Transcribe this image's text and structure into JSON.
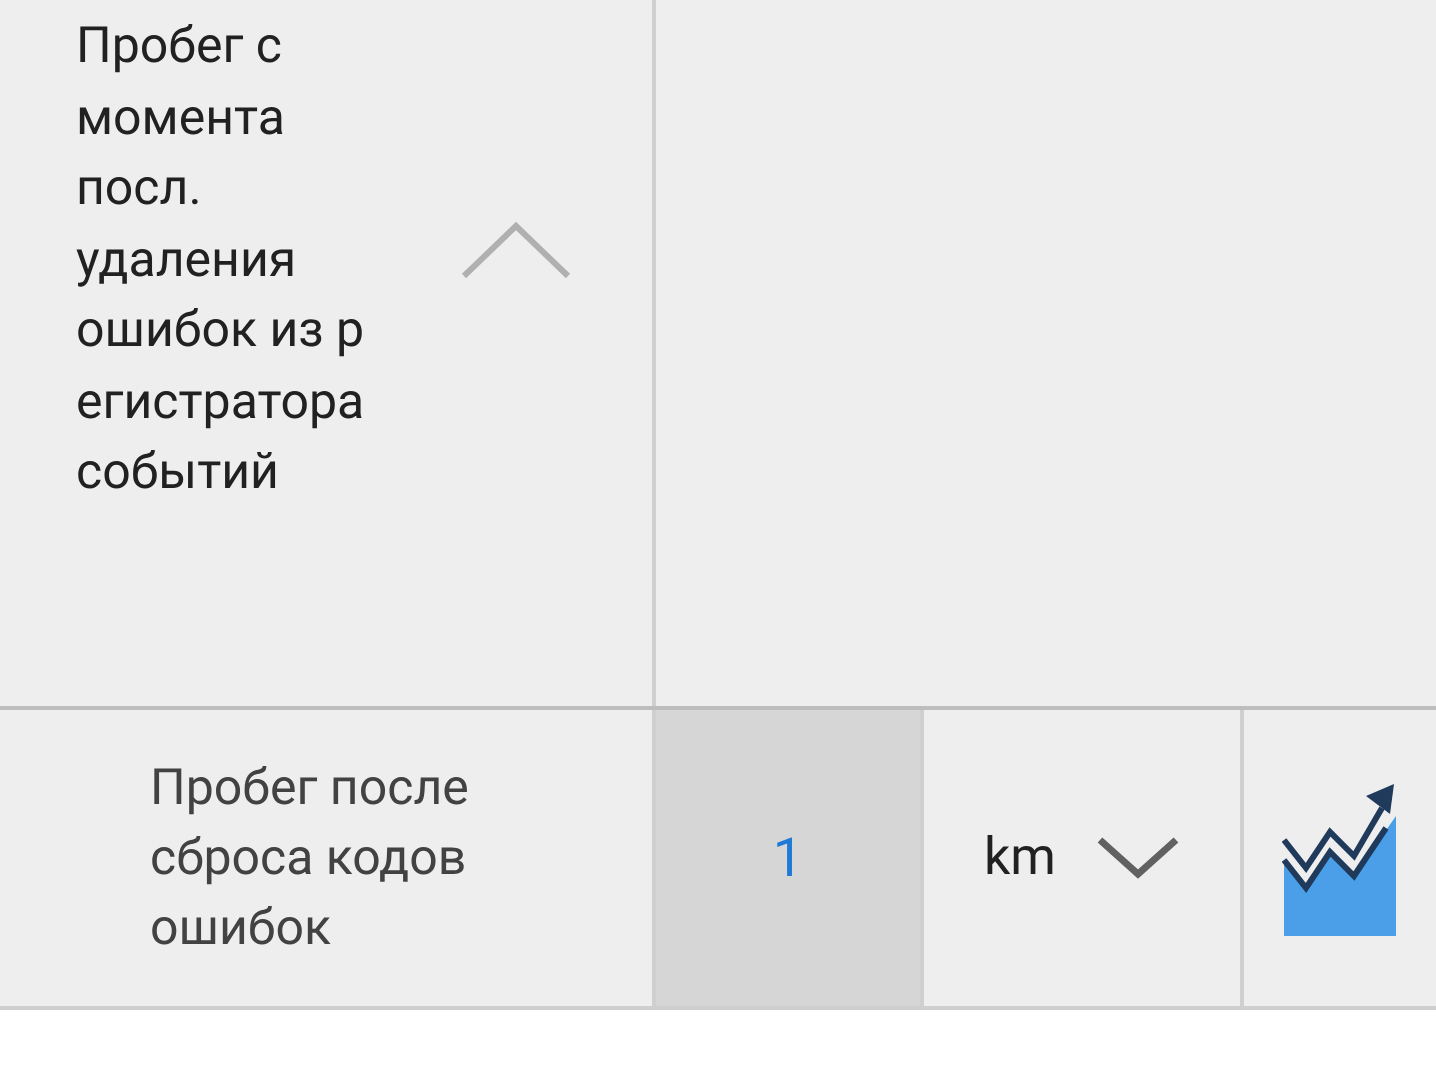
{
  "header_row": {
    "label": "Пробег с\nмомента\nпосл.\nудаления\nошибок из р\nегистратора\nсобытий",
    "expanded": true
  },
  "value_row": {
    "label": "Пробег после\nсброса кодов\nошибок",
    "value": "1",
    "unit": "km"
  }
}
